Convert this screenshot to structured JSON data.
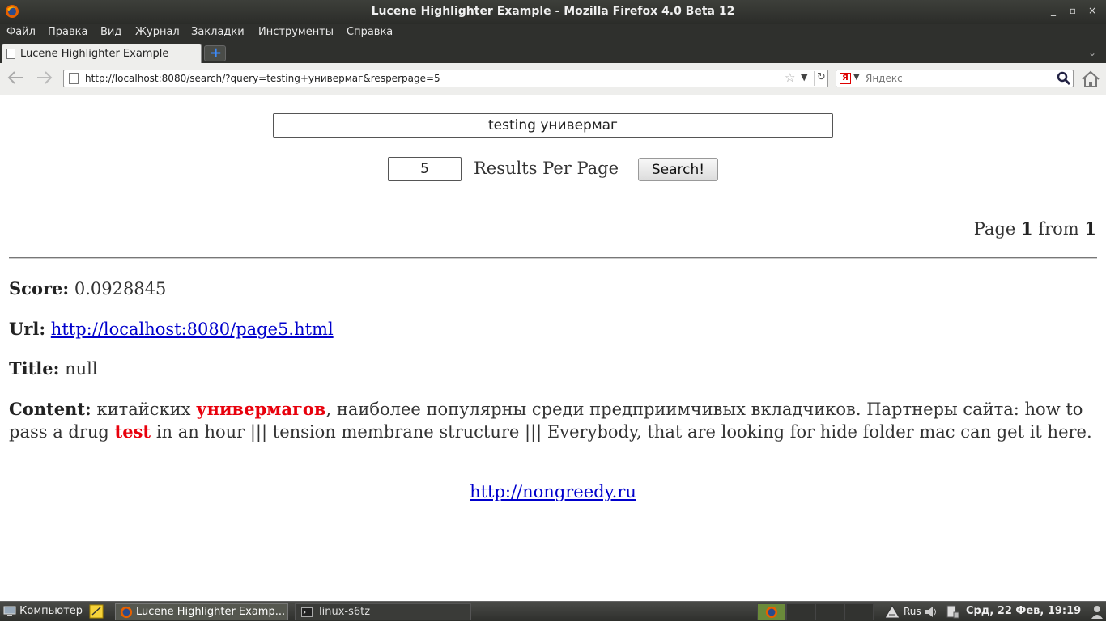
{
  "window": {
    "title": "Lucene Highlighter Example - Mozilla Firefox 4.0 Beta 12",
    "minimize": "_",
    "maximize": "▫",
    "close": "×"
  },
  "menu": [
    "Файл",
    "Правка",
    "Вид",
    "Журнал",
    "Закладки",
    "Инструменты",
    "Справка"
  ],
  "tabs": [
    {
      "label": "Lucene Highlighter Example"
    }
  ],
  "newtab_label": "+",
  "navbar": {
    "url": "http://localhost:8080/search/?query=testing+универмаг&resperpage=5",
    "search_placeholder": "Яндекс",
    "search_engine_glyph": "Я"
  },
  "form": {
    "query_value": "testing универмаг",
    "perpage_value": "5",
    "perpage_label": "Results Per Page",
    "search_button": "Search!"
  },
  "pagination": {
    "prefix": "Page",
    "current": "1",
    "middle": "from",
    "total": "1"
  },
  "result": {
    "score_label": "Score:",
    "score_value": "0.0928845",
    "url_label": "Url:",
    "url_value": "http://localhost:8080/page5.html",
    "title_label": "Title:",
    "title_value": "null",
    "content_label": "Content:",
    "content_part1": "китайских",
    "content_hl1": "универмагов",
    "content_part2": ", наиболее популярны среди предприимчивых вкладчиков. Партнеры сайта: how to pass a drug",
    "content_hl2": "test",
    "content_part3": "in an hour ||| tension membrane structure ||| Everybody, that are looking for hide folder mac can get it here."
  },
  "footer_link": "http://nongreedy.ru",
  "taskbar": {
    "start_label": "Компьютер",
    "tasks": [
      "Lucene Highlighter Examp...",
      "linux-s6tz"
    ],
    "lang": "Rus",
    "clock": "Срд, 22 Фев, 19:19"
  },
  "colors": {
    "highlight": "#e8000c",
    "link": "#0000cc"
  }
}
